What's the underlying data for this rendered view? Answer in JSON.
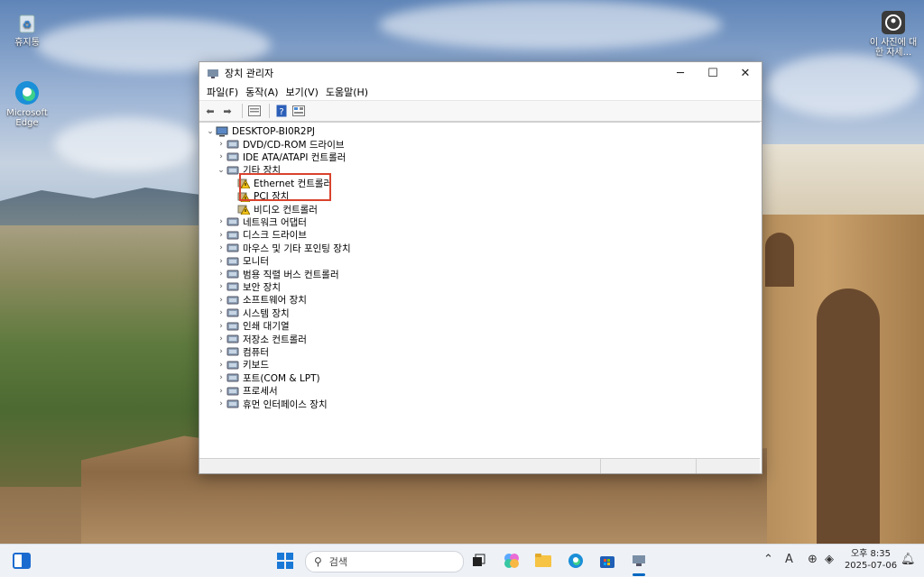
{
  "desktop": {
    "icons": [
      {
        "label": "휴지통",
        "icon": "recycle-bin-icon"
      },
      {
        "label": "Microsoft Edge",
        "icon": "edge-icon"
      },
      {
        "label": "이 사진에 대한 자세...",
        "icon": "info-photo-icon"
      }
    ]
  },
  "window": {
    "title": "장치 관리자",
    "menu": [
      "파일(F)",
      "동작(A)",
      "보기(V)",
      "도움말(H)"
    ],
    "root": "DESKTOP-BI0R2PJ",
    "tree": [
      {
        "label": "DVD/CD-ROM 드라이브",
        "icon": "dvd-icon",
        "expanded": false
      },
      {
        "label": "IDE ATA/ATAPI 컨트롤러",
        "icon": "ide-controller-icon",
        "expanded": false
      },
      {
        "label": "기타 장치",
        "icon": "other-devices-icon",
        "expanded": true
      },
      {
        "label": "Ethernet 컨트롤러",
        "icon": "warning-device-icon",
        "child": true
      },
      {
        "label": "PCI 장치",
        "icon": "warning-device-icon",
        "child": true
      },
      {
        "label": "비디오 컨트롤러",
        "icon": "warning-device-icon",
        "child": true
      },
      {
        "label": "네트워크 어댑터",
        "icon": "network-adapter-icon",
        "expanded": false
      },
      {
        "label": "디스크 드라이브",
        "icon": "disk-drive-icon",
        "expanded": false
      },
      {
        "label": "마우스 및 기타 포인팅 장치",
        "icon": "mouse-icon",
        "expanded": false
      },
      {
        "label": "모니터",
        "icon": "monitor-icon",
        "expanded": false
      },
      {
        "label": "범용 직렬 버스 컨트롤러",
        "icon": "usb-icon",
        "expanded": false
      },
      {
        "label": "보안 장치",
        "icon": "security-device-icon",
        "expanded": false
      },
      {
        "label": "소프트웨어 장치",
        "icon": "software-device-icon",
        "expanded": false
      },
      {
        "label": "시스템 장치",
        "icon": "system-device-icon",
        "expanded": false
      },
      {
        "label": "인쇄 대기열",
        "icon": "print-queue-icon",
        "expanded": false
      },
      {
        "label": "저장소 컨트롤러",
        "icon": "storage-controller-icon",
        "expanded": false
      },
      {
        "label": "컴퓨터",
        "icon": "computer-icon",
        "expanded": false
      },
      {
        "label": "키보드",
        "icon": "keyboard-icon",
        "expanded": false
      },
      {
        "label": "포트(COM & LPT)",
        "icon": "port-icon",
        "expanded": false
      },
      {
        "label": "프로세서",
        "icon": "processor-icon",
        "expanded": false
      },
      {
        "label": "휴먼 인터페이스 장치",
        "icon": "hid-icon",
        "expanded": false
      }
    ]
  },
  "taskbar": {
    "search_placeholder": "검색",
    "clock_time": "오후 8:35",
    "clock_date": "2025-07-06"
  },
  "colors": {
    "highlight": "#d9432e",
    "accent": "#0067c0"
  }
}
